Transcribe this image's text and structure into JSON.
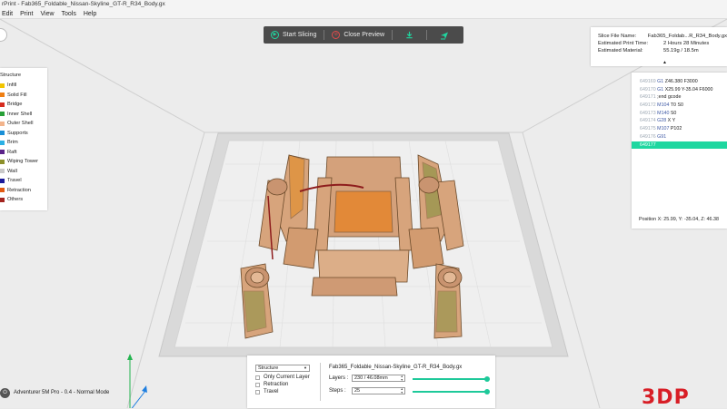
{
  "window": {
    "title": "rPrint - Fab365_Foldable_Nissan-Skyline_GT-R_R34_Body.gx"
  },
  "menu": {
    "items": [
      "Edit",
      "Print",
      "View",
      "Tools",
      "Help"
    ]
  },
  "toolbar": {
    "start_slicing": "Start Slicing",
    "close_preview": "Close Preview",
    "icons": [
      "play-icon",
      "no-preview-icon",
      "download-icon",
      "send-icon"
    ]
  },
  "legend": {
    "title": "Structure",
    "items": [
      {
        "label": "Infill",
        "color": "#f2c500"
      },
      {
        "label": "Solid Fill",
        "color": "#ef7f13"
      },
      {
        "label": "Bridge",
        "color": "#d62b1f"
      },
      {
        "label": "Inner Shell",
        "color": "#27a037"
      },
      {
        "label": "Outer Shell",
        "color": "#f2b48c"
      },
      {
        "label": "Supports",
        "color": "#1a8fd6"
      },
      {
        "label": "Brim",
        "color": "#2bb0e4"
      },
      {
        "label": "Raft",
        "color": "#5b2389"
      },
      {
        "label": "Wiping Tower",
        "color": "#8c8f2a"
      },
      {
        "label": "Wall",
        "color": "#c9c9c9"
      },
      {
        "label": "Travel",
        "color": "#1b1b9a"
      },
      {
        "label": "Retraction",
        "color": "#e25a12"
      },
      {
        "label": "Others",
        "color": "#a3241f"
      }
    ]
  },
  "info": {
    "rows": [
      {
        "key": "Slice File Name:",
        "value": "Fab365_Foldab...R_R34_Body.gx"
      },
      {
        "key": "Estimated Print Time:",
        "value": "2 Hours 28 Minutes"
      },
      {
        "key": "Estimated Material:",
        "value": "55.19g / 18.5m"
      }
    ]
  },
  "gcode": {
    "lines": [
      {
        "num": "649169",
        "cmd": "G1",
        "rest": " Z46.380 F3000"
      },
      {
        "num": "649170",
        "cmd": "G1",
        "rest": " X25.99 Y-35.04 F6000"
      },
      {
        "num": "649171",
        "cmd": "",
        "rest": ";end gcode"
      },
      {
        "num": "649172",
        "cmd": "M104",
        "rest": " T0 S0"
      },
      {
        "num": "649173",
        "cmd": "M140",
        "rest": " S0"
      },
      {
        "num": "649174",
        "cmd": "G28",
        "rest": " X Y"
      },
      {
        "num": "649175",
        "cmd": "M107",
        "rest": " P102"
      },
      {
        "num": "649176",
        "cmd": "G91",
        "rest": ""
      },
      {
        "num": "649177",
        "cmd": "",
        "rest": ""
      }
    ],
    "position": "Position   X: 25.99,  Y: -35.04,  Z: 46.38"
  },
  "bottom": {
    "view_mode": "Structure",
    "checkboxes": [
      "Only Current Layer",
      "Retraction",
      "Travel"
    ],
    "file_name": "Fab365_Foldable_Nissan-Skyline_GT-R_R34_Body.gx",
    "layers_label": "Layers :",
    "layers_value": "230 / 46.08mm",
    "steps_label": "Steps :",
    "steps_value": "25",
    "layers_fraction": 0.98,
    "steps_fraction": 0.98
  },
  "printer": {
    "status": "Adventurer 5M Pro - 0.4 - Normal Mode"
  },
  "brand": {
    "logo": "3DP"
  },
  "colors": {
    "accent": "#1fd7a0",
    "toolbar_bg": "#4b4b4b",
    "logo": "#d81e26"
  }
}
